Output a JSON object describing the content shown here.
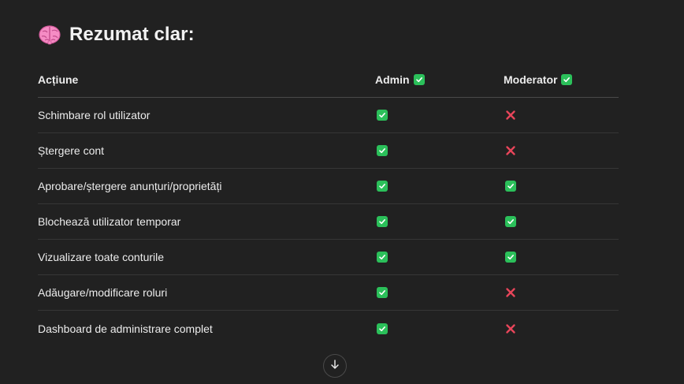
{
  "heading": {
    "emoji_icon": "brain-icon",
    "title": "Rezumat clar:"
  },
  "table": {
    "columns": [
      "Acțiune",
      "Admin",
      "Moderator"
    ],
    "header_icons": [
      "",
      "check-icon",
      "check-icon"
    ],
    "rows": [
      {
        "action": "Schimbare rol utilizator",
        "admin": "yes",
        "moderator": "no"
      },
      {
        "action": "Ștergere cont",
        "admin": "yes",
        "moderator": "no"
      },
      {
        "action": "Aprobare/ștergere anunțuri/proprietăți",
        "admin": "yes",
        "moderator": "yes"
      },
      {
        "action": "Blochează utilizator temporar",
        "admin": "yes",
        "moderator": "yes"
      },
      {
        "action": "Vizualizare toate conturile",
        "admin": "yes",
        "moderator": "yes"
      },
      {
        "action": "Adăugare/modificare roluri",
        "admin": "yes",
        "moderator": "no"
      },
      {
        "action": "Dashboard de administrare complet",
        "admin": "yes",
        "moderator": "no"
      }
    ]
  },
  "colors": {
    "background": "#212121",
    "check_green": "#2bc05a",
    "cross_red": "#e8455a",
    "text": "#ececec",
    "divider": "#363636"
  },
  "scroll_button": {
    "icon": "arrow-down-icon"
  }
}
